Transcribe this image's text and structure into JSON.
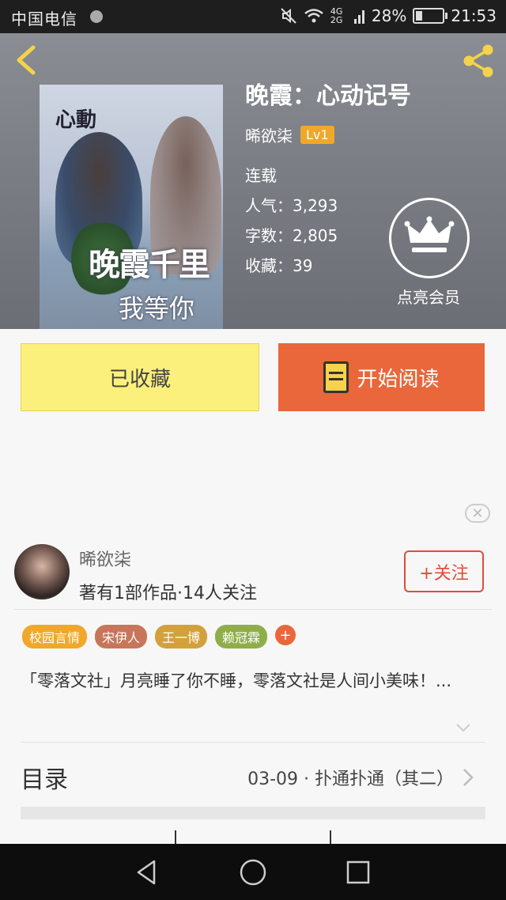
{
  "status_bar": {
    "carrier": "中国电信",
    "network": "4G 2G",
    "battery": "28%",
    "time": "21:53"
  },
  "book": {
    "title": "晚霞：心动记号",
    "author": "晞欲柒",
    "level": "Lv1",
    "status": "连载",
    "popularity": "人气：3,293",
    "word_count": "字数：2,805",
    "favorites": "收藏：39",
    "cover": {
      "top_text": "心動",
      "title_text": "晚霞千里",
      "sub_text": "我等你"
    }
  },
  "vip": {
    "label": "点亮会员"
  },
  "actions": {
    "favorite_label": "已收藏",
    "read_label": "开始阅读"
  },
  "ad": {
    "close_glyph": "✕"
  },
  "author_card": {
    "name": "晞欲柒",
    "stats": "著有1部作品·14人关注",
    "follow_label": "+关注"
  },
  "tags": [
    {
      "label": "校园言情",
      "color": "#f0a82a"
    },
    {
      "label": "宋伊人",
      "color": "#c8765a"
    },
    {
      "label": "王一博",
      "color": "#d3a13c"
    },
    {
      "label": "赖冠霖",
      "color": "#8fae4a"
    }
  ],
  "tag_more": "+",
  "description": "「零落文社」月亮睡了你不睡，零落文社是人间小美味！...",
  "toc": {
    "label": "目录",
    "latest": "03-09 · 扑通扑通（其二）"
  },
  "tabs_peek": [
    "",
    "",
    ""
  ],
  "icons": {
    "back": "back-arrow-icon",
    "share": "share-icon",
    "crown": "crown-icon",
    "book": "book-icon"
  },
  "colors": {
    "accent_orange": "#e9673a",
    "favorite_yellow": "#fbf07b",
    "follow_red": "#e24b3a",
    "icon_yellow": "#f7d24c"
  }
}
